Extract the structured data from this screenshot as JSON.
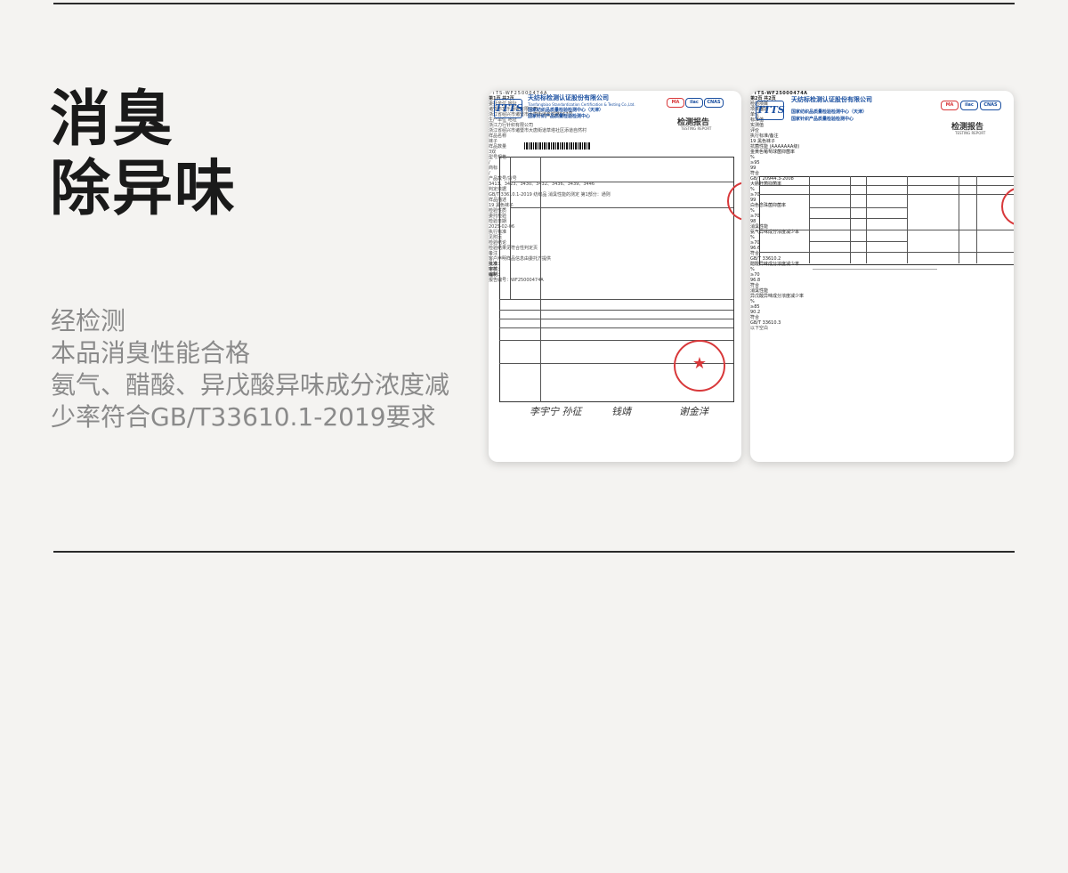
{
  "heading": {
    "line1": "消臭",
    "line2": "除异味"
  },
  "description": {
    "line1": "经检测",
    "line2": "本品消臭性能合格",
    "line3": "氨气、醋酸、异戊酸异味成分浓度减",
    "line4": "少率符合GB/T33610.1-2019要求"
  },
  "report1": {
    "logo": "TTTS",
    "company": "天纺标检测认证股份有限公司",
    "company_en": "Tianfangbiao Standardization Certification & Testing Co.,Ltd.",
    "center1": "国家纺织品质量检验检测中心（天津）",
    "center2": "国家针织产品质量检验检测中心",
    "cert_marks": [
      "MA",
      "ilac",
      "CNAS"
    ],
    "report_title": "检测报告",
    "report_title_en": "TESTING REPORT",
    "barcode_text": "TTTS-WF25000474A",
    "page": "第1页 共2页",
    "rows": [
      {
        "label": "委托单位 地址",
        "value": "诸暨市富乐服装有限公司"
      },
      {
        "label": "",
        "value": "浙江省绍兴市诸暨市大唐街道金柏路567号"
      },
      {
        "label": "生产单位 地址",
        "value": "浙江力行针织有限公司"
      },
      {
        "label": "",
        "value": "浙江省绍兴市诸暨市大唐街道草塔社区添道自然村"
      },
      {
        "label": "样品名称",
        "value": "袜子"
      },
      {
        "label": "样品数量",
        "value": "3双"
      },
      {
        "label": "型号规格",
        "value": "/"
      },
      {
        "label": "商标",
        "value": "/"
      },
      {
        "label": "产品款号/货号",
        "value": "3413、3423、3430、3432、3436、3439、3446"
      },
      {
        "label": "判定依据",
        "value": "GB/T 33610.1-2019 纺织品 消臭性能的测定 第1部分：通则"
      },
      {
        "label": "样品描述",
        "value": "19 黑色袜子"
      },
      {
        "label": "检验性质",
        "value": "委托检验"
      },
      {
        "label": "检验日期",
        "value": "2025-02-06"
      },
      {
        "label": "执行标准",
        "value": "见附页"
      },
      {
        "label": "检验结论",
        "value": "检验结果见符合性判定页"
      },
      {
        "label": "备注",
        "value": "客户声明样品信息由委托方提供"
      }
    ],
    "sign_labels": [
      "批准：",
      "审核：",
      "编制："
    ],
    "signatures": [
      "李宇宁 孙征",
      "钱靖",
      "谢金洋"
    ],
    "footer": "报告编号：WF25000474A"
  },
  "report2": {
    "logo": "TTTS",
    "company": "天纺标检测认证股份有限公司",
    "center1": "国家纺织品质量检验检测中心（天津）",
    "center2": "国家针织产品质量检验检测中心",
    "cert_marks": [
      "MA",
      "ilac",
      "CNAS"
    ],
    "report_title": "检测报告",
    "report_title_en": "TESTING REPORT",
    "report_no": "TTTS-WF25000474A",
    "page": "第2页 共2页",
    "headers": [
      "检验项目",
      "项目描述",
      "单位",
      "标准值",
      "实测值",
      "评价",
      "执行标准/备注"
    ],
    "sample": "19  黑色袜子",
    "table": [
      {
        "group": "抗菌性能 (AAAAAAA级)",
        "item": "金黄色葡萄球菌抑菌率",
        "unit": "%",
        "std": "≥95",
        "val": "99",
        "eval": "符合",
        "note": "GB/T 20944.3-2008"
      },
      {
        "group": "",
        "item": "大肠杆菌抑菌率",
        "unit": "%",
        "std": "≥70",
        "val": "99",
        "eval": "",
        "note": ""
      },
      {
        "group": "",
        "item": "白色念珠菌抑菌率",
        "unit": "%",
        "std": "≥70",
        "val": "98",
        "eval": "",
        "note": ""
      },
      {
        "group": "消臭性能",
        "item": "氨气异味成分浓度减少率",
        "unit": "%",
        "std": "≥70",
        "val": "96.6",
        "eval": "符合",
        "note": "GB/T 33610.2"
      },
      {
        "group": "",
        "item": "醋酸异味成分浓度减少率",
        "unit": "%",
        "std": "≥70",
        "val": "96.8",
        "eval": "符合",
        "note": ""
      },
      {
        "group": "消臭性能",
        "item": "异戊酸异味成分浓度减少率",
        "unit": "%",
        "std": "≥85",
        "val": "90.2",
        "eval": "符合",
        "note": "GB/T 33610.3"
      }
    ],
    "end_text": "以下空白"
  }
}
